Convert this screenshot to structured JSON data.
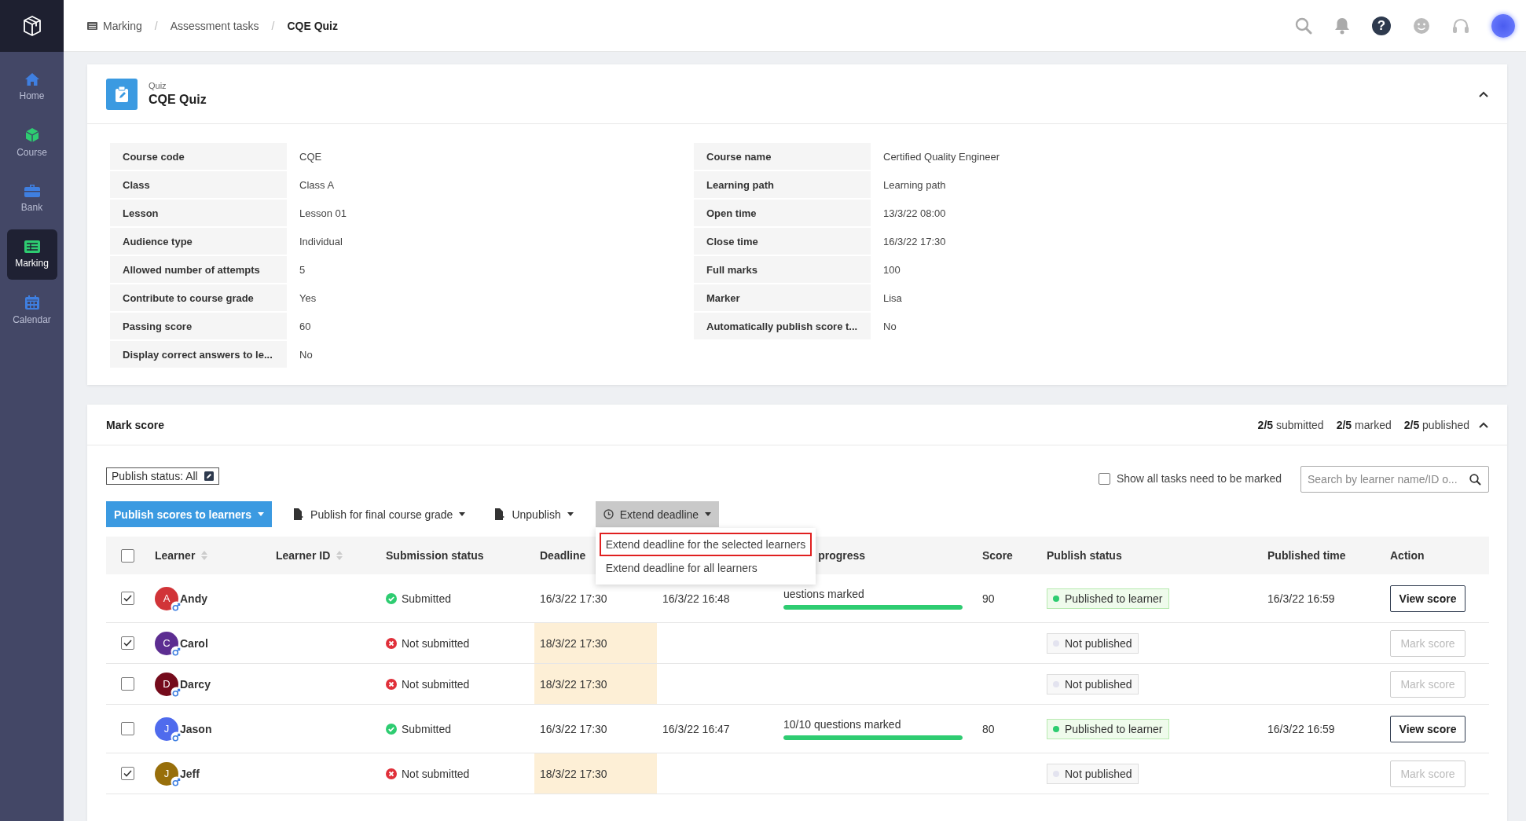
{
  "sidebar": {
    "items": [
      {
        "label": "Home",
        "selected": false
      },
      {
        "label": "Course",
        "selected": false
      },
      {
        "label": "Bank",
        "selected": false
      },
      {
        "label": "Marking",
        "selected": true
      },
      {
        "label": "Calendar",
        "selected": false
      }
    ]
  },
  "topbar": {
    "breadcrumb": [
      "Marking",
      "Assessment tasks",
      "CQE Quiz"
    ],
    "separator": "/",
    "help": "?"
  },
  "quiz": {
    "type": "Quiz",
    "title": "CQE Quiz",
    "expanded": true,
    "details": [
      {
        "label": "Course code",
        "value": "CQE"
      },
      {
        "label": "Course name",
        "value": "Certified Quality Engineer"
      },
      {
        "label": "Class",
        "value": "Class A"
      },
      {
        "label": "Learning path",
        "value": "Learning path"
      },
      {
        "label": "Lesson",
        "value": "Lesson 01"
      },
      {
        "label": "Open time",
        "value": "13/3/22 08:00"
      },
      {
        "label": "Audience type",
        "value": "Individual"
      },
      {
        "label": "Close time",
        "value": "16/3/22 17:30"
      },
      {
        "label": "Allowed number of attempts",
        "value": "5"
      },
      {
        "label": "Full marks",
        "value": "100"
      },
      {
        "label": "Contribute to course grade",
        "value": "Yes"
      },
      {
        "label": "Marker",
        "value": "Lisa"
      },
      {
        "label": "Passing score",
        "value": "60"
      },
      {
        "label": "Automatically publish score t...",
        "value": "No"
      },
      {
        "label": "Display correct answers to le...",
        "value": "No"
      }
    ]
  },
  "mark_score": {
    "title": "Mark score",
    "expanded": true,
    "stats": [
      {
        "count": "2/5",
        "label": "submitted"
      },
      {
        "count": "2/5",
        "label": "marked"
      },
      {
        "count": "2/5",
        "label": "published"
      }
    ],
    "filter": "Publish status: All",
    "show_all": {
      "label": "Show all tasks need to be marked",
      "checked": false
    },
    "search": {
      "placeholder": "Search by learner name/ID o..."
    },
    "actions": [
      {
        "label": "Publish scores to learners",
        "kind": "primary",
        "expanded": false
      },
      {
        "label": "Publish for final course grade",
        "kind": "menu",
        "expanded": false
      },
      {
        "label": "Unpublish",
        "kind": "menu",
        "expanded": false
      },
      {
        "label": "Extend deadline",
        "kind": "menu",
        "expanded": true
      }
    ],
    "menu": [
      {
        "label": "Extend deadline for the selected learners",
        "selected": true
      },
      {
        "label": "Extend deadline for all learners",
        "selected": false
      }
    ],
    "table": {
      "all_selected": false,
      "columns": [
        {
          "label": "Learner",
          "sortable": true
        },
        {
          "label": "Learner ID",
          "sortable": true
        },
        {
          "label": "Submission status",
          "sortable": false
        },
        {
          "label": "Deadline",
          "sortable": false
        },
        null,
        {
          "label": "progress",
          "sortable": false
        },
        {
          "label": "Score",
          "sortable": false
        },
        {
          "label": "Publish status",
          "sortable": false
        },
        {
          "label": "Published time",
          "sortable": false
        },
        {
          "label": "Action",
          "sortable": false
        }
      ],
      "rows": [
        {
          "selected": true,
          "initial": "A",
          "name": "Andy",
          "color": "#d13438",
          "submitted": true,
          "status": "Submitted",
          "deadline": "16/3/22 17:30",
          "extended": false,
          "submitted_time": "16/3/22 16:48",
          "progress": {
            "text": "uestions marked",
            "level": 1
          },
          "score": "90",
          "published": true,
          "publish_status": "Published to learner",
          "published_time": "16/3/22 16:59",
          "action": {
            "label": "View score",
            "disabled": false
          }
        },
        {
          "selected": true,
          "initial": "C",
          "name": "Carol",
          "color": "#5c2d91",
          "submitted": false,
          "status": "Not submitted",
          "deadline": "18/3/22 17:30",
          "extended": true,
          "published": false,
          "publish_status": "Not published",
          "action": {
            "label": "Mark score",
            "disabled": true
          }
        },
        {
          "selected": false,
          "initial": "D",
          "name": "Darcy",
          "color": "#750b1c",
          "submitted": false,
          "status": "Not submitted",
          "deadline": "18/3/22 17:30",
          "extended": true,
          "published": false,
          "publish_status": "Not published",
          "action": {
            "label": "Mark score",
            "disabled": true
          }
        },
        {
          "selected": false,
          "initial": "J",
          "name": "Jason",
          "color": "#4f6bed",
          "submitted": true,
          "status": "Submitted",
          "deadline": "16/3/22 17:30",
          "extended": false,
          "submitted_time": "16/3/22 16:47",
          "progress": {
            "text": "10/10 questions marked",
            "level": 1
          },
          "score": "80",
          "published": true,
          "publish_status": "Published to learner",
          "published_time": "16/3/22 16:59",
          "action": {
            "label": "View score",
            "disabled": false
          }
        },
        {
          "selected": true,
          "initial": "J",
          "name": "Jeff",
          "color": "#986f0b",
          "submitted": false,
          "status": "Not submitted",
          "deadline": "18/3/22 17:30",
          "extended": true,
          "published": false,
          "publish_status": "Not published",
          "action": {
            "label": "Mark score",
            "disabled": true
          }
        }
      ]
    }
  }
}
